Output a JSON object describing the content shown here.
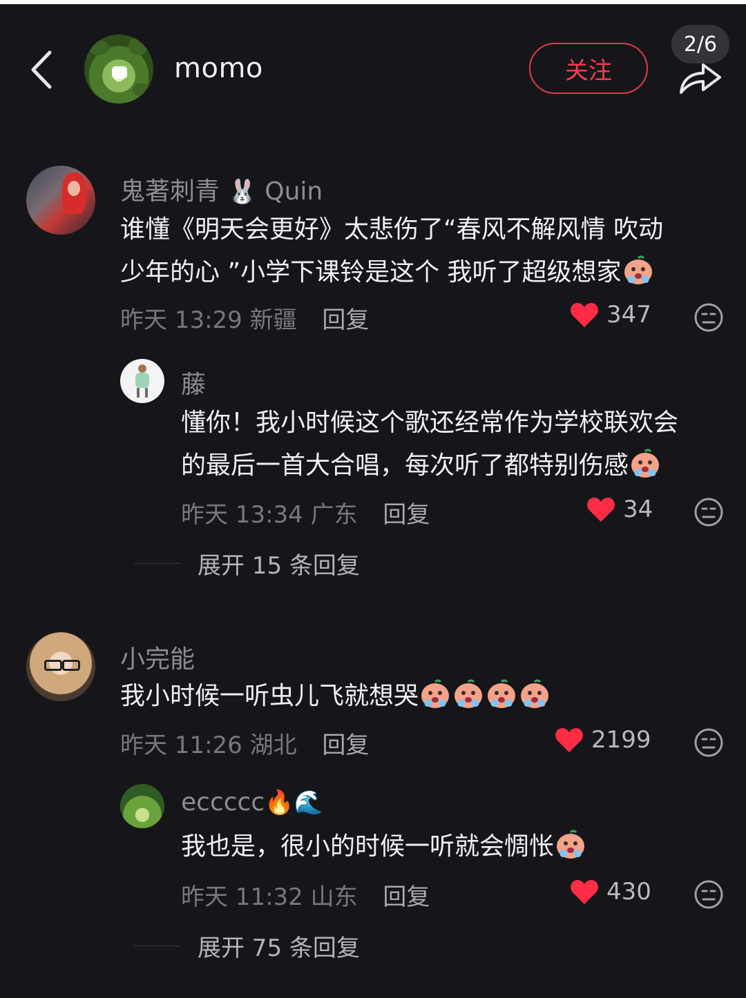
{
  "header": {
    "username": "momo",
    "follow_label": "关注",
    "page_indicator": "2/6"
  },
  "comments": [
    {
      "user": "鬼著刺青",
      "user_emoji": "🐰",
      "user_suffix": "Quin",
      "text_line1": "谁懂《明天会更好》太悲伤了“春风不解风情 吹动",
      "text_line2": "少年的心 ”小学下课铃是这个 我听了超级想家",
      "time": "昨天 13:29",
      "location": "新疆",
      "reply_label": "回复",
      "likes": "347",
      "replies": [
        {
          "user": "藤",
          "text_line1": "懂你！我小时候这个歌还经常作为学校联欢会",
          "text_line2": "的最后一首大合唱，每次听了都特别伤感",
          "time": "昨天 13:34",
          "location": "广东",
          "reply_label": "回复",
          "likes": "34"
        }
      ],
      "expand_label": "展开 15 条回复"
    },
    {
      "user": "小完能",
      "text_line1": "我小时候一听虫儿飞就想哭",
      "time": "昨天 11:26",
      "location": "湖北",
      "reply_label": "回复",
      "likes": "2199",
      "replies": [
        {
          "user": "eccccc",
          "user_emoji": "🔥🌊",
          "text_line1": "我也是，很小的时候一听就会惆怅",
          "time": "昨天 11:32",
          "location": "山东",
          "reply_label": "回复",
          "likes": "430"
        }
      ],
      "expand_label": "展开 75 条回复"
    }
  ],
  "colors": {
    "background": "#16161a",
    "accent_red": "#ff3b50",
    "like_red": "#ff2c45"
  },
  "icons": [
    "back-arrow-icon",
    "share-icon",
    "heart-icon",
    "dislike-face-icon",
    "crying-emoji-icon"
  ]
}
